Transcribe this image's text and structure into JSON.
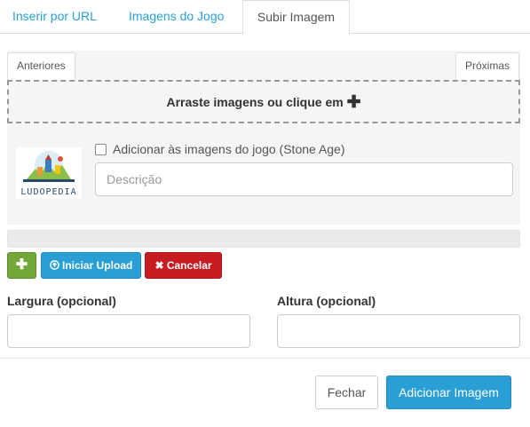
{
  "tabs": [
    {
      "label": "Inserir por URL"
    },
    {
      "label": "Imagens do Jogo"
    },
    {
      "label": "Subir Imagem"
    }
  ],
  "upload": {
    "prev_label": "Anteriores",
    "next_label": "Próximas",
    "dropzone_text": "Arraste imagens ou clique em",
    "dropzone_icon": "plus-icon",
    "image_logo_text": "LUDOPEDIA",
    "add_to_game_label": "Adicionar às imagens do jogo (Stone Age)",
    "add_to_game_checked": false,
    "description_placeholder": "Descrição",
    "progress": 0
  },
  "actions": {
    "add_icon": "plus-icon",
    "start_label": "Iniciar Upload",
    "start_icon": "arrow-circle-up-icon",
    "cancel_label": "Cancelar",
    "cancel_icon": "times-icon"
  },
  "dimensions": {
    "width_label": "Largura (opcional)",
    "width_value": "",
    "height_label": "Altura (opcional)",
    "height_value": ""
  },
  "footer": {
    "close_label": "Fechar",
    "submit_label": "Adicionar Imagem"
  },
  "colors": {
    "primary": "#2a9fd6",
    "success": "#73a839",
    "danger": "#c71c22"
  }
}
